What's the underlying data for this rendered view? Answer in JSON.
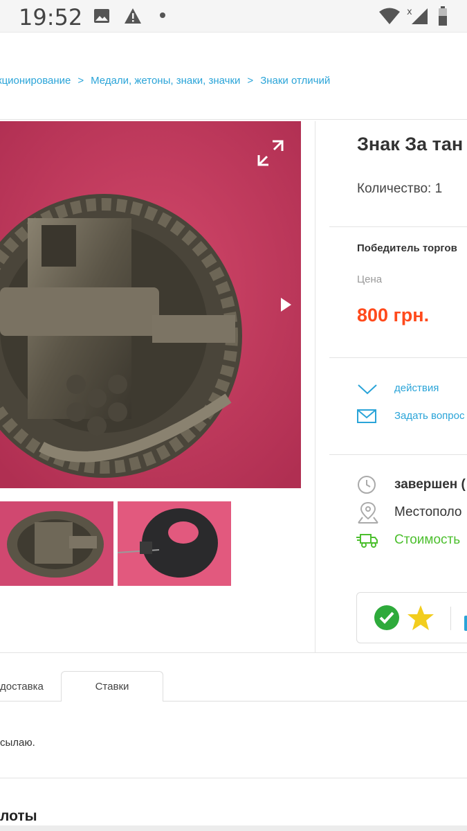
{
  "status_bar": {
    "time": "19:52",
    "icons": [
      "image-icon",
      "warning-icon",
      "dot-icon",
      "wifi-icon",
      "signal-icon",
      "battery-icon"
    ]
  },
  "breadcrumb": {
    "items": [
      "кционирование",
      "Медали, жетоны, знаки, значки",
      "Знаки отличий"
    ],
    "separator": ">"
  },
  "listing": {
    "title": "Знак За тан",
    "quantity": "Количество: 1",
    "winner_label": "Победитель торгов",
    "price_label": "Цена",
    "price": "800 грн."
  },
  "actions": {
    "dropdown": "действия",
    "ask_question": "Задать вопрос"
  },
  "info": {
    "status": "завершен (",
    "location": "Местополо",
    "shipping": "Стоимость"
  },
  "tabs": [
    "доставка",
    "Ставки"
  ],
  "description": "сылаю.",
  "section_heading": "лоты",
  "colors": {
    "link": "#2aa4d8",
    "price": "#ff4a1c",
    "shipping": "#4cbf2e",
    "photo_bg": "#c23a5c"
  }
}
